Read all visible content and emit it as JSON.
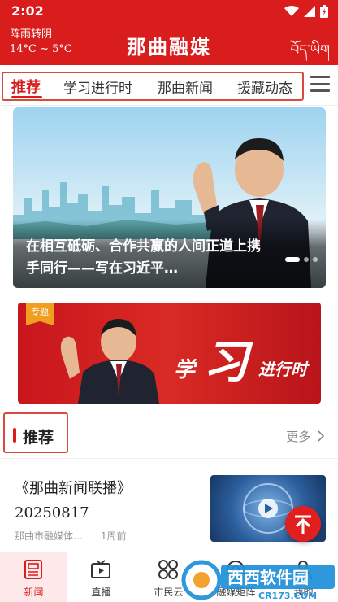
{
  "status_bar": {
    "time": "2:02"
  },
  "header": {
    "weather_line1": "阵雨转阴",
    "weather_line2": "14°C ~ 5°C",
    "title": "那曲融媒",
    "language_toggle": "བོད་ཡིག"
  },
  "tabs": [
    {
      "label": "推荐",
      "active": true
    },
    {
      "label": "学习进行时",
      "active": false
    },
    {
      "label": "那曲新闻",
      "active": false
    },
    {
      "label": "援藏动态",
      "active": false
    }
  ],
  "banner": {
    "title": "在相互砥砺、合作共赢的人间正道上携手同行——写在习近平…",
    "slide_count": 3,
    "active_slide": 1
  },
  "topic_banner": {
    "badge": "专题",
    "logo_text_1": "学",
    "logo_text_2": "习",
    "logo_text_3": "进行时"
  },
  "section": {
    "title": "推荐",
    "more": "更多"
  },
  "news": [
    {
      "title": "《那曲新闻联播》20250817",
      "source": "那曲市融媒体…",
      "time": "1周前"
    }
  ],
  "bottom_nav": [
    {
      "label": "新闻",
      "icon": "newspaper-icon",
      "active": true
    },
    {
      "label": "直播",
      "icon": "tv-play-icon",
      "active": false
    },
    {
      "label": "市民云",
      "icon": "cloud-grid-icon",
      "active": false
    },
    {
      "label": "融媒矩阵",
      "icon": "matrix-icon",
      "active": false
    },
    {
      "label": "我的",
      "icon": "user-icon",
      "active": false
    }
  ],
  "watermark": {
    "brand": "西西软件园",
    "domain": "CR173.COM"
  },
  "colors": {
    "brand_red": "#d91c1c",
    "highlight_frame": "#d94b3a"
  }
}
